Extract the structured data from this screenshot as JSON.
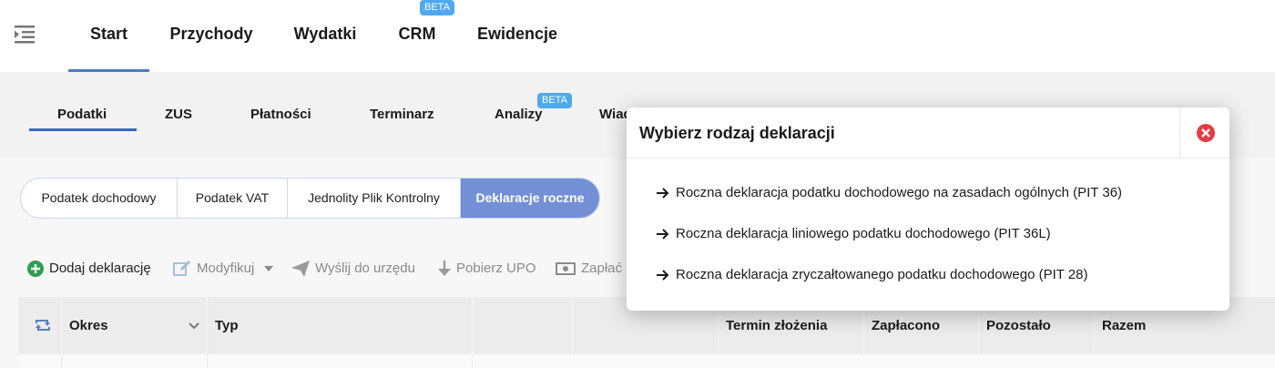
{
  "topnav": {
    "items": [
      {
        "label": "Start",
        "active": true
      },
      {
        "label": "Przychody"
      },
      {
        "label": "Wydatki"
      },
      {
        "label": "CRM",
        "badge": "BETA"
      },
      {
        "label": "Ewidencje"
      }
    ]
  },
  "subnav": {
    "items": [
      {
        "label": "Podatki",
        "active": true
      },
      {
        "label": "ZUS"
      },
      {
        "label": "Płatności"
      },
      {
        "label": "Terminarz"
      },
      {
        "label": "Analizy",
        "badge": "BETA"
      },
      {
        "label": "Wiad"
      }
    ]
  },
  "segments": [
    {
      "label": "Podatek dochodowy"
    },
    {
      "label": "Podatek VAT"
    },
    {
      "label": "Jednolity Plik Kontrolny"
    },
    {
      "label": "Deklaracje roczne",
      "active": true
    }
  ],
  "toolbar": {
    "add": "Dodaj deklarację",
    "modify": "Modyfikuj",
    "send": "Wyślij do urzędu",
    "upo": "Pobierz UPO",
    "pay": "Zapłać"
  },
  "table": {
    "headers": [
      "Okres",
      "Typ",
      "Termin złożenia",
      "Zapłacono",
      "Pozostało",
      "Razem"
    ]
  },
  "modal": {
    "title": "Wybierz rodzaj deklaracji",
    "options": [
      "Roczna deklaracja podatku dochodowego na zasadach ogólnych (PIT 36)",
      "Roczna deklaracja liniowego podatku dochodowego (PIT 36L)",
      "Roczna deklaracja zryczałtowanego podatku dochodowego (PIT 28)"
    ]
  },
  "colors": {
    "accent": "#4a7bd0",
    "segment_active": "#7390d6",
    "beta_badge": "#4ea9ef",
    "add_icon": "#2e9e4f",
    "close_icon": "#e43c44"
  }
}
